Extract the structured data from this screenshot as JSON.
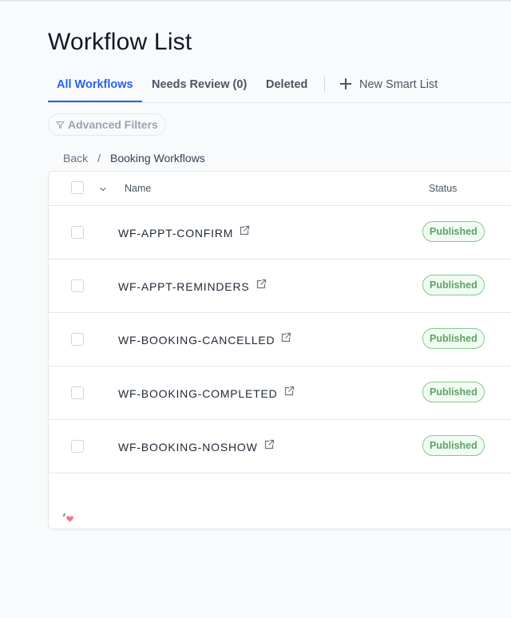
{
  "page": {
    "title": "Workflow List"
  },
  "tabs": [
    {
      "label": "All Workflows",
      "active": true
    },
    {
      "label": "Needs Review (0)",
      "active": false
    },
    {
      "label": "Deleted",
      "active": false
    },
    {
      "label": "New Smart List",
      "active": false,
      "icon": "plus-icon"
    }
  ],
  "filters": {
    "advanced_label": "Advanced Filters",
    "icon": "filter-icon"
  },
  "breadcrumb": {
    "back_label": "Back",
    "separator": "/",
    "current": "Booking Workflows"
  },
  "table": {
    "columns": [
      "Name",
      "Status"
    ],
    "rows": [
      {
        "name": "WF-APPT-CONFIRM",
        "status": "Published"
      },
      {
        "name": "WF-APPT-REMINDERS",
        "status": "Published"
      },
      {
        "name": "WF-BOOKING-CANCELLED",
        "status": "Published"
      },
      {
        "name": "WF-BOOKING-COMPLETED",
        "status": "Published"
      },
      {
        "name": "WF-BOOKING-NOSHOW",
        "status": "Published"
      }
    ]
  },
  "colors": {
    "accent": "#2563eb",
    "status_published_text": "#5ea366",
    "status_published_border": "#86c98f",
    "status_published_bg": "#f0fbf1",
    "footer_heart": "#f87189"
  }
}
